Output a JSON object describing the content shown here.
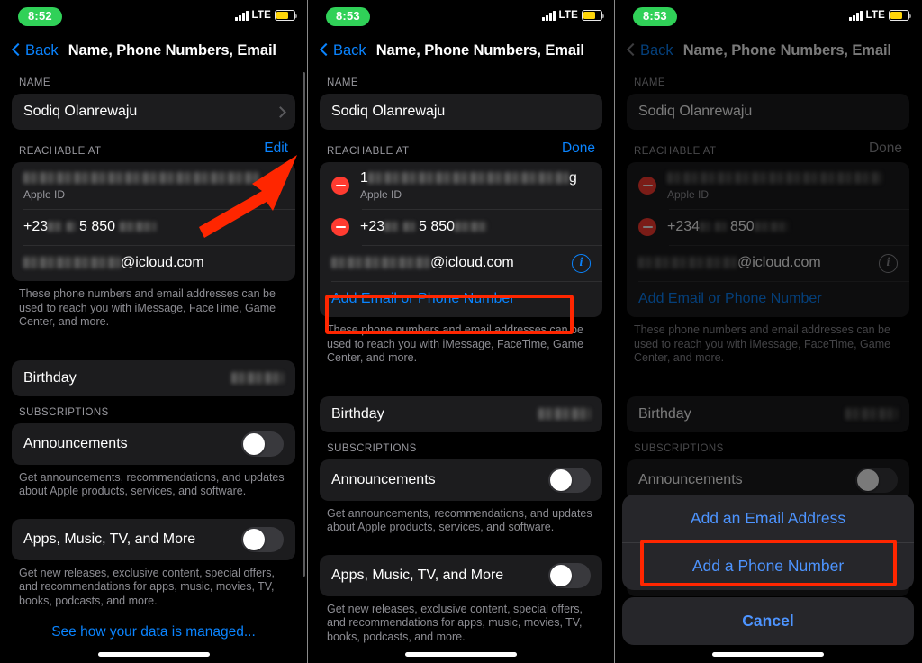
{
  "meta": {
    "accent_blue": "#0a84ff",
    "annotation_red": "#ff2600",
    "status_green": "#30d158",
    "card_bg": "#1c1c1e",
    "battery_yellow": "#ffd60a"
  },
  "status_bar": {
    "time_left": "8:52",
    "time_mid": "8:53",
    "time_right": "8:53",
    "network": "LTE",
    "signal_icon": "cellular-bars-icon",
    "battery_icon": "battery-icon"
  },
  "nav": {
    "back_label": "Back",
    "back_icon": "chevron-left-icon",
    "title": "Name, Phone Numbers, Email"
  },
  "sections": {
    "name_header": "NAME",
    "name_value": "Sodiq Olanrewaju",
    "reachable_header": "REACHABLE AT",
    "edit_label": "Edit",
    "done_label": "Done",
    "apple_id_sublabel": "Apple ID",
    "phone_value": "+23██ 5 850 ████",
    "phone_value_right": "+234█ ██ 850█ ███",
    "email_domain": "@icloud.com",
    "add_email_or_phone": "Add Email or Phone Number",
    "reachable_footnote": "These phone numbers and email addresses can be used to reach you with iMessage, FaceTime, Game Center, and more.",
    "birthday_label": "Birthday",
    "subscriptions_header": "SUBSCRIPTIONS",
    "announcements_label": "Announcements",
    "announcements_footnote": "Get announcements, recommendations, and updates about Apple products, services, and software.",
    "apps_music_label": "Apps, Music, TV, and More",
    "apps_music_footnote": "Get new releases, exclusive content, special offers, and recommendations for apps, music, movies, TV, books, podcasts, and more.",
    "see_how_link": "See how your data is managed..."
  },
  "action_sheet": {
    "add_email": "Add an Email Address",
    "add_phone": "Add a Phone Number",
    "cancel": "Cancel"
  },
  "annotations": {
    "arrow_target": "Edit",
    "highlight_1": "Add Email or Phone Number",
    "highlight_2": "Add a Phone Number"
  }
}
